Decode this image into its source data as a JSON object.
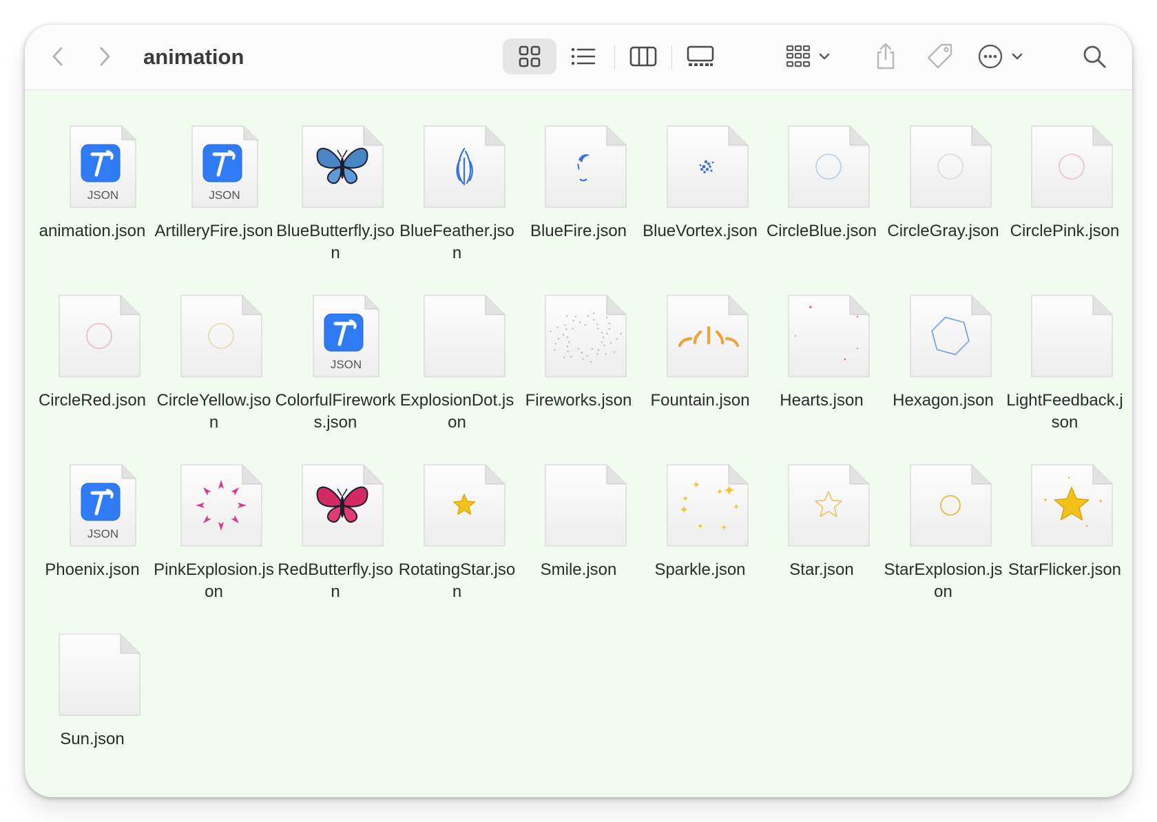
{
  "window": {
    "title": "animation",
    "toolbar": {
      "back_icon": "chevron-left-icon",
      "forward_icon": "chevron-right-icon",
      "views": [
        "icon-view",
        "list-view",
        "column-view",
        "gallery-view"
      ],
      "selected_view": "icon-view",
      "group_icon": "group-by-icon",
      "share_icon": "share-icon",
      "tag_icon": "tag-icon",
      "more_icon": "more-actions-icon",
      "search_icon": "search-icon"
    }
  },
  "files": [
    {
      "name": "animation.json",
      "icon": "json-app"
    },
    {
      "name": "ArtilleryFire.json",
      "icon": "json-app"
    },
    {
      "name": "BlueButterfly.json",
      "icon": "blue-butterfly"
    },
    {
      "name": "BlueFeather.json",
      "icon": "blue-feather"
    },
    {
      "name": "BlueFire.json",
      "icon": "blue-fire"
    },
    {
      "name": "BlueVortex.json",
      "icon": "blue-vortex"
    },
    {
      "name": "CircleBlue.json",
      "icon": "circle-blue"
    },
    {
      "name": "CircleGray.json",
      "icon": "circle-gray"
    },
    {
      "name": "CirclePink.json",
      "icon": "circle-pink"
    },
    {
      "name": "CircleRed.json",
      "icon": "circle-red"
    },
    {
      "name": "CircleYellow.json",
      "icon": "circle-yellow"
    },
    {
      "name": "ColorfulFireworks.json",
      "icon": "json-app"
    },
    {
      "name": "ExplosionDot.json",
      "icon": "blank"
    },
    {
      "name": "Fireworks.json",
      "icon": "fireworks-dots"
    },
    {
      "name": "Fountain.json",
      "icon": "fountain"
    },
    {
      "name": "Hearts.json",
      "icon": "hearts-dots"
    },
    {
      "name": "Hexagon.json",
      "icon": "hexagon"
    },
    {
      "name": "LightFeedback.json",
      "icon": "blank"
    },
    {
      "name": "Phoenix.json",
      "icon": "json-app"
    },
    {
      "name": "PinkExplosion.json",
      "icon": "pink-explosion"
    },
    {
      "name": "RedButterfly.json",
      "icon": "red-butterfly"
    },
    {
      "name": "RotatingStar.json",
      "icon": "small-star"
    },
    {
      "name": "Smile.json",
      "icon": "blank"
    },
    {
      "name": "Sparkle.json",
      "icon": "sparkles"
    },
    {
      "name": "Star.json",
      "icon": "star-outline"
    },
    {
      "name": "StarExplosion.json",
      "icon": "circle-gold"
    },
    {
      "name": "StarFlicker.json",
      "icon": "gold-star"
    },
    {
      "name": "Sun.json",
      "icon": "blank"
    }
  ],
  "json_badge_label": "JSON",
  "colors": {
    "window_bg": "#f1fbf0",
    "toolbar_bg": "#fbfbfb",
    "app_icon_blue": "#2f7cf6"
  }
}
